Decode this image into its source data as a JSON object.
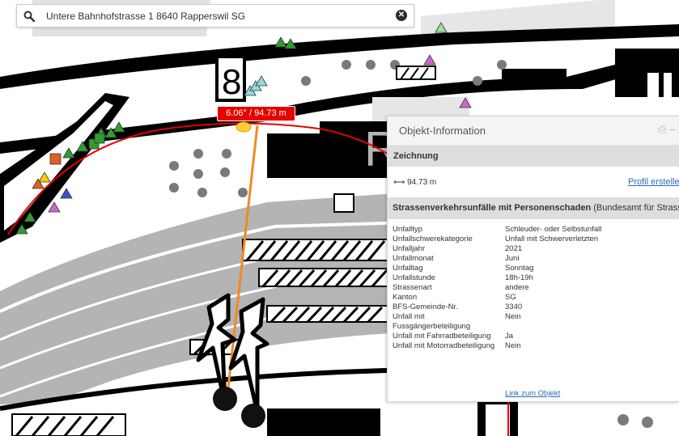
{
  "search": {
    "value": "Untere Bahnhofstrasse 1 8640 Rapperswil SG",
    "icon": "search-icon",
    "clear_icon": "clear-icon"
  },
  "map": {
    "measurement_label": "6.06° / 94.73 m",
    "sign_number": "8",
    "building_letter": "R",
    "colors": {
      "circle": "#e60000",
      "line": "#f08a24",
      "buildings": "#000000",
      "tracks": "#b4b4b4"
    }
  },
  "panel": {
    "title": "Objekt-Information",
    "tools": "⎙ – ✕",
    "section_title": "Zeichnung",
    "distance": "94.73 m",
    "distance_icon": "arrows-horizontal-icon",
    "profile_link": "Profil erstellen",
    "layer_title": "Strassenverkehrsunfälle mit Personenschaden",
    "layer_source": "(Bundesamt für Strassen ASTRA)",
    "attributes": [
      {
        "key": "Unfalltyp",
        "value": "Schleuder- oder Selbstunfall"
      },
      {
        "key": "Unfallschwerekategorie",
        "value": "Unfall mit Schwerverletzten"
      },
      {
        "key": "Unfalljahr",
        "value": "2021"
      },
      {
        "key": "Unfallmonat",
        "value": "Juni"
      },
      {
        "key": "Unfalltag",
        "value": "Sonntag"
      },
      {
        "key": "Unfallstunde",
        "value": "18h-19h"
      },
      {
        "key": "Strassenart",
        "value": "andere"
      },
      {
        "key": "Kanton",
        "value": "SG"
      },
      {
        "key": "BFS-Gemeinde-Nr.",
        "value": "3340"
      },
      {
        "key": "Unfall mit Fussgängerbeteiligung",
        "value": "Nein"
      },
      {
        "key": "Unfall mit Fahrradbeteiligung",
        "value": "Ja"
      },
      {
        "key": "Unfall mit Motorradbeteiligung",
        "value": "Nein"
      }
    ],
    "object_link": "Link zum Objekt"
  }
}
